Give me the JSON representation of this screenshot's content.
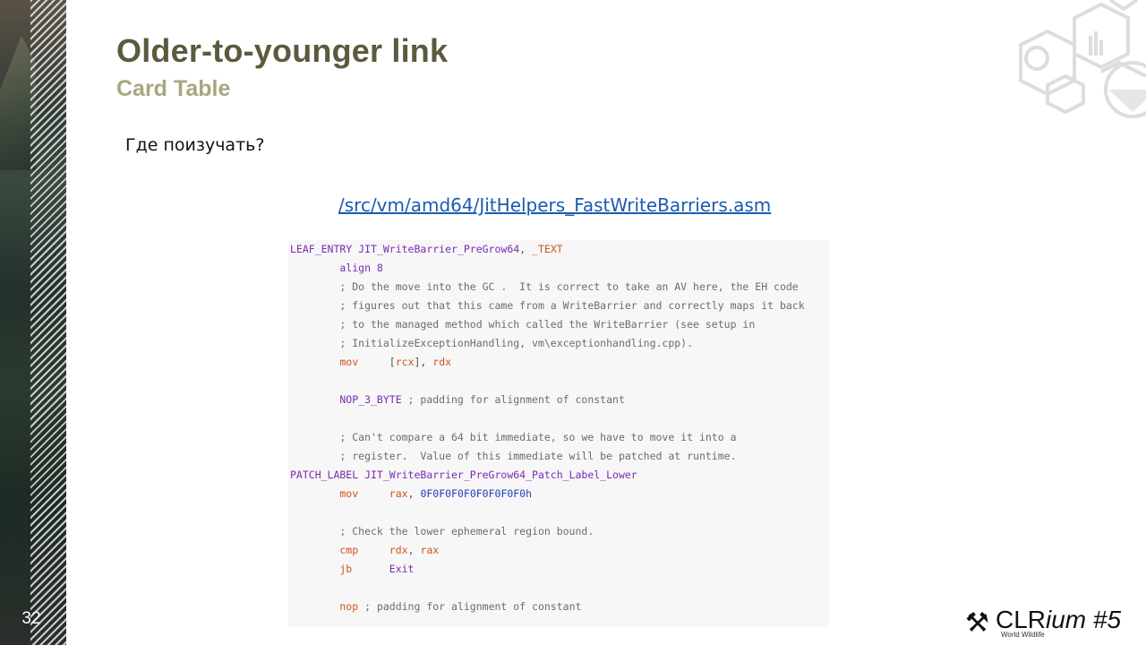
{
  "slide": {
    "number": "32",
    "title": "Older-to-younger link",
    "subtitle": "Card Table",
    "question": "Где поизучать?",
    "link_text": "/src/vm/amd64/JitHelpers_FastWriteBarriers.asm"
  },
  "code": {
    "line0_a": "LEAF_ENTRY JIT_WriteBarrier_PreGrow64",
    "line0_b": ", ",
    "line0_c": "_TEXT",
    "line1_a": "        align 8",
    "line2": "        ; Do the move into the GC .  It is correct to take an AV here, the EH code",
    "line3": "        ; figures out that this came from a WriteBarrier and correctly maps it back",
    "line4": "        ; to the managed method which called the WriteBarrier (see setup in",
    "line5": "        ; InitializeExceptionHandling, vm\\exceptionhandling.cpp).",
    "line6_a": "        mov",
    "line6_b": "     [",
    "line6_c": "rcx",
    "line6_d": "], ",
    "line6_e": "rdx",
    "line8_a": "        NOP_3_BYTE",
    "line8_b": " ; padding for alignment of constant",
    "line10": "        ; Can't compare a 64 bit immediate, so we have to move it into a",
    "line11": "        ; register.  Value of this immediate will be patched at runtime.",
    "line12": "PATCH_LABEL JIT_WriteBarrier_PreGrow64_Patch_Label_Lower",
    "line13_a": "        mov",
    "line13_b": "     ",
    "line13_c": "rax",
    "line13_d": ", ",
    "line13_e": "0F0F0F0F0F0F0F0F0h",
    "line15": "        ; Check the lower ephemeral region bound.",
    "line16_a": "        cmp",
    "line16_b": "     ",
    "line16_c": "rdx",
    "line16_d": ", ",
    "line16_e": "rax",
    "line17_a": "        jb",
    "line17_b": "      Exit",
    "line19_a": "        nop",
    "line19_b": " ; padding for alignment of constant"
  },
  "brand": {
    "name_main": "CLR",
    "name_italic": "ium #5",
    "tagline": "World Wildlife",
    "icon": "crossed-tools-icon"
  },
  "colors": {
    "title": "#5c5a3e",
    "subtitle": "#a8a67f",
    "link": "#1a5bb0",
    "code_bg": "#f7f7f7"
  }
}
